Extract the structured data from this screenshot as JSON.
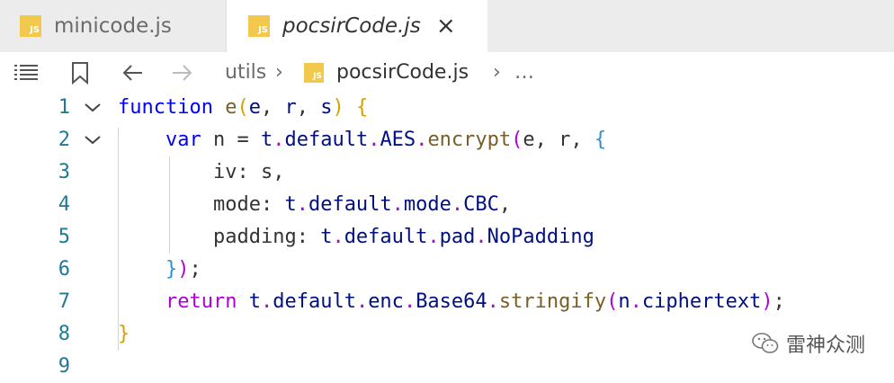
{
  "tabs": [
    {
      "label": "minicode.js",
      "icon": "js-file-icon",
      "active": false
    },
    {
      "label": "pocsirCode.js",
      "icon": "js-file-icon",
      "active": true,
      "close": "×"
    }
  ],
  "js_badge": "JS",
  "breadcrumb": {
    "folder": "utils",
    "file": "pocsirCode.js",
    "more": "…",
    "separator": "›"
  },
  "editor": {
    "line_numbers": [
      "1",
      "2",
      "3",
      "4",
      "5",
      "6",
      "7",
      "8",
      "9"
    ],
    "lines": {
      "l1": {
        "kw": "function",
        "fn": "e",
        "p_open": "(",
        "a1": "e",
        "c1": ", ",
        "a2": "r",
        "c2": ", ",
        "a3": "s",
        "p_close": ")",
        "brace": "{"
      },
      "l2": {
        "kw": "var",
        "v": " n = ",
        "o1": "t",
        "d1": ".",
        "o2": "default",
        "d2": ".",
        "o3": "AES",
        "d3": ".",
        "fn": "encrypt",
        "p_open": "(",
        "args": "e, r, ",
        "brace": "{"
      },
      "l3": {
        "key": "iv",
        "sep": ": ",
        "val": "s",
        "comma": ","
      },
      "l4": {
        "key": "mode",
        "sep": ": ",
        "o1": "t",
        "d1": ".",
        "o2": "default",
        "d2": ".",
        "o3": "mode",
        "d3": ".",
        "val": "CBC",
        "comma": ","
      },
      "l5": {
        "key": "padding",
        "sep": ": ",
        "o1": "t",
        "d1": ".",
        "o2": "default",
        "d2": ".",
        "o3": "pad",
        "d3": ".",
        "val": "NoPadding"
      },
      "l6": {
        "brace": "}",
        "paren": ")",
        "semi": ";"
      },
      "l7": {
        "kw": "return",
        "o1": " t",
        "d1": ".",
        "o2": "default",
        "d2": ".",
        "o3": "enc",
        "d3": ".",
        "o4": "Base64",
        "d4": ".",
        "fn": "stringify",
        "p_open": "(",
        "a1": "n",
        "d5": ".",
        "a2": "ciphertext",
        "p_close": ")",
        "semi": ";"
      },
      "l8": {
        "brace": "}"
      }
    }
  },
  "watermark": {
    "text": "雷神众测",
    "icon": "wechat-icon"
  },
  "icons": {
    "list": "list-icon",
    "bookmark": "bookmark-icon",
    "back": "arrow-left-icon",
    "forward": "arrow-right-icon",
    "fold": "chevron-down-icon"
  },
  "colors": {
    "js": "#f2c94c",
    "keyword": "#0000ff",
    "control": "#af00db",
    "function": "#795e26",
    "line_number": "#237893"
  }
}
